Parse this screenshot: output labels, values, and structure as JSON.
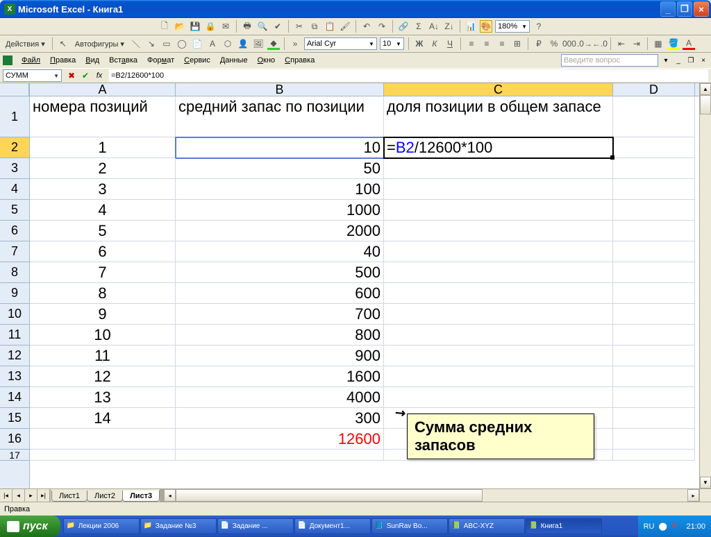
{
  "window": {
    "title": "Microsoft Excel - Книга1"
  },
  "toolbar1": {
    "actions_label": "Действия",
    "autoshapes_label": "Автофигуры",
    "font": "Arial Cyr",
    "fontsize": "10",
    "zoom": "180%"
  },
  "menu": {
    "items": [
      "Файл",
      "Правка",
      "Вид",
      "Вставка",
      "Формат",
      "Сервис",
      "Данные",
      "Окно",
      "Справка"
    ],
    "question_placeholder": "Введите вопрос"
  },
  "formula_bar": {
    "name_box": "СУММ",
    "formula": "=B2/12600*100"
  },
  "grid": {
    "columns": [
      "A",
      "B",
      "C",
      "D"
    ],
    "headers": {
      "A": "номера позиций",
      "B": "средний запас по позиции",
      "C": "доля позиции в общем запасе"
    },
    "rows": [
      {
        "n": "1",
        "a": "1",
        "b": "10",
        "c_formula": "=B2/12600*100"
      },
      {
        "n": "2",
        "a": "2",
        "b": "50"
      },
      {
        "n": "3",
        "a": "3",
        "b": "100"
      },
      {
        "n": "4",
        "a": "4",
        "b": "1000"
      },
      {
        "n": "5",
        "a": "5",
        "b": "2000"
      },
      {
        "n": "6",
        "a": "6",
        "b": "40"
      },
      {
        "n": "7",
        "a": "7",
        "b": "500"
      },
      {
        "n": "8",
        "a": "8",
        "b": "600"
      },
      {
        "n": "9",
        "a": "9",
        "b": "700"
      },
      {
        "n": "10",
        "a": "10",
        "b": "800"
      },
      {
        "n": "11",
        "a": "11",
        "b": "900"
      },
      {
        "n": "12",
        "a": "12",
        "b": "1600"
      },
      {
        "n": "13",
        "a": "13",
        "b": "4000"
      },
      {
        "n": "14",
        "a": "14",
        "b": "300"
      }
    ],
    "sum_row": {
      "n": "16",
      "b": "12600"
    },
    "active_cell_ref": "B2",
    "callout": "Сумма средних запасов"
  },
  "sheets": {
    "tabs": [
      "Лист1",
      "Лист2",
      "Лист3"
    ],
    "active": 2
  },
  "status": {
    "text": "Правка"
  },
  "taskbar": {
    "start": "пуск",
    "items": [
      "Лекции 2006",
      "Задание №3",
      "Задание ...",
      "Документ1...",
      "SunRav Bo...",
      "ABC-XYZ",
      "Книга1"
    ],
    "lang": "RU",
    "time": "21:00"
  }
}
